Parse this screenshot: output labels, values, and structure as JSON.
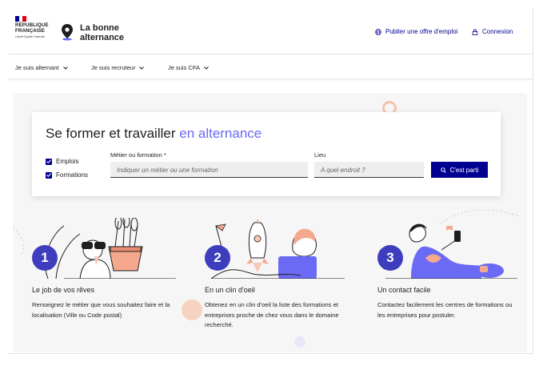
{
  "header": {
    "republique": "RÉPUBLIQUE FRANÇAISE",
    "motto": "Liberté Égalité Fraternité",
    "logo_text": "La bonne alternance",
    "publish_label": "Publier une offre d'emploi",
    "login_label": "Connexion"
  },
  "nav": {
    "items": [
      {
        "label": "Je suis alternant"
      },
      {
        "label": "Je suis recruteur"
      },
      {
        "label": "Je suis CFA"
      }
    ]
  },
  "search": {
    "title_main": "Se former et travailler ",
    "title_accent": "en alternance",
    "checkboxes": [
      {
        "label": "Emplois",
        "checked": true
      },
      {
        "label": "Formations",
        "checked": true
      }
    ],
    "metier_label": "Métier ou formation *",
    "metier_placeholder": "Indiquer un métier ou une formation",
    "lieu_label": "Lieu",
    "lieu_placeholder": "A quel endroit ?",
    "submit_label": "C'est parti"
  },
  "steps": [
    {
      "number": "1",
      "title": "Le job de vos rêves",
      "text": "Renseignez le métier que vous souhaitez faire et la localisation (Ville ou Code postal)"
    },
    {
      "number": "2",
      "title": "En un clin d'oeil",
      "text": "Obtenez en un clin d'oeil la liste des formations et entreprises proche de chez vous dans le domaine recherché."
    },
    {
      "number": "3",
      "title": "Un contact facile",
      "text": "Contactez facilement les centres de formations ou les entreprises pour postuler."
    }
  ],
  "colors": {
    "primary": "#000091",
    "accent": "#6a6af4",
    "step_badge": "#3d3dbd",
    "peach": "#f8c9b4",
    "hero_bg": "#f6f6f6"
  }
}
